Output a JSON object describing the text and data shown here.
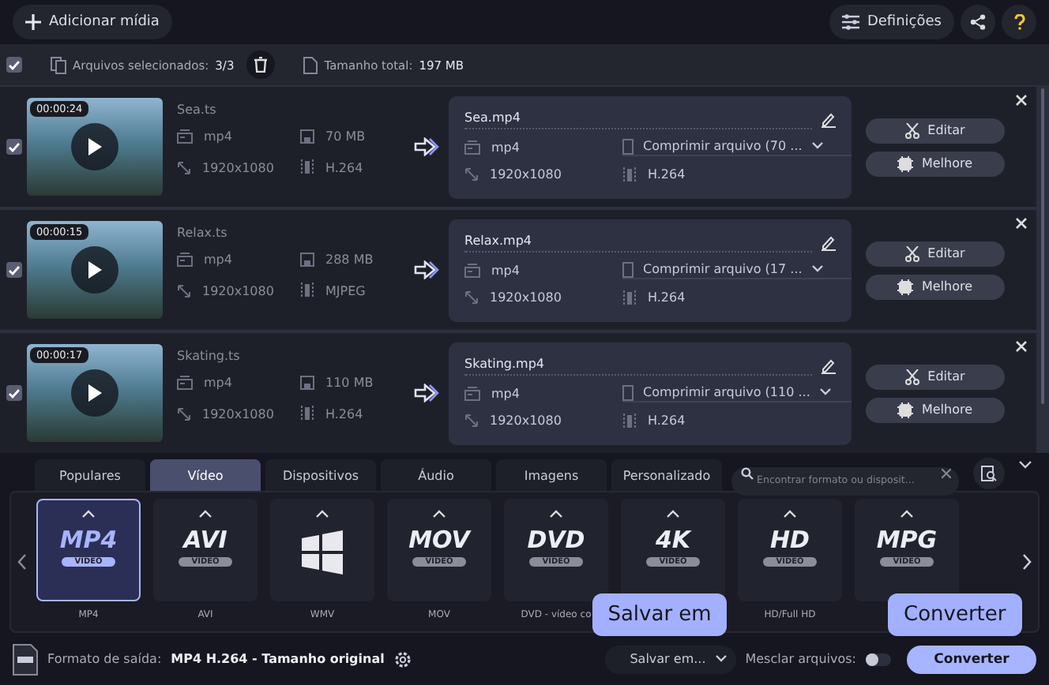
{
  "toolbar": {
    "add_media": "Adicionar mídia",
    "settings": "Definições"
  },
  "selection_bar": {
    "all_checked": true,
    "selected_label": "Arquivos selecionados:",
    "selected_count": "3/3",
    "total_label": "Tamanho total:",
    "total_size": "197 MB"
  },
  "files": [
    {
      "checked": true,
      "duration": "00:00:24",
      "name": "Sea.ts",
      "format": "mp4",
      "size": "70 MB",
      "resolution": "1920x1080",
      "codec": "H.264",
      "output": {
        "name": "Sea.mp4",
        "format": "mp4",
        "profile": "Comprimir arquivo (70 ...",
        "resolution": "1920x1080",
        "codec": "H.264"
      },
      "edit": "Editar",
      "enhance": "Melhore"
    },
    {
      "checked": true,
      "duration": "00:00:15",
      "name": "Relax.ts",
      "format": "mp4",
      "size": "288 MB",
      "resolution": "1920x1080",
      "codec": "MJPEG",
      "output": {
        "name": "Relax.mp4",
        "format": "mp4",
        "profile": "Comprimir arquivo (17 ...",
        "resolution": "1920x1080",
        "codec": "H.264"
      },
      "edit": "Editar",
      "enhance": "Melhore"
    },
    {
      "checked": true,
      "duration": "00:00:17",
      "name": "Skating.ts",
      "format": "mp4",
      "size": "110 MB",
      "resolution": "1920x1080",
      "codec": "H.264",
      "output": {
        "name": "Skating.mp4",
        "format": "mp4",
        "profile": "Comprimir arquivo (110 ...",
        "resolution": "1920x1080",
        "codec": "H.264"
      },
      "edit": "Editar",
      "enhance": "Melhore"
    }
  ],
  "format_tabs": [
    {
      "label": "Populares",
      "selected": false
    },
    {
      "label": "Vídeo",
      "selected": true
    },
    {
      "label": "Dispositivos",
      "selected": false
    },
    {
      "label": "Áudio",
      "selected": false
    },
    {
      "label": "Imagens",
      "selected": false
    },
    {
      "label": "Personalizado",
      "selected": false
    }
  ],
  "format_search": {
    "placeholder": "Encontrar formato ou disposit..."
  },
  "formats": [
    {
      "kind": "text",
      "logo": "MP4",
      "sub": "VIDEO",
      "label": "MP4",
      "selected": true
    },
    {
      "kind": "text",
      "logo": "AVI",
      "sub": "VIDEO",
      "label": "AVI",
      "selected": false
    },
    {
      "kind": "windows",
      "label": "WMV",
      "selected": false
    },
    {
      "kind": "text",
      "logo": "MOV",
      "sub": "VIDEO",
      "label": "MOV",
      "selected": false
    },
    {
      "kind": "text",
      "logo": "DVD",
      "sub": "VIDEO",
      "label": "DVD - vídeo co",
      "selected": false
    },
    {
      "kind": "text",
      "logo": "4K",
      "sub": "VIDEO",
      "selected": false
    },
    {
      "kind": "text",
      "logo": "HD",
      "sub": "VIDEO",
      "label": "HD/Full HD",
      "selected": false
    },
    {
      "kind": "text",
      "logo": "MPG",
      "sub": "VIDEO",
      "selected": false
    }
  ],
  "output_bar": {
    "format_label": "Formato de saída:",
    "format_value": "MP4 H.264 - Tamanho original",
    "save_to": "Salvar em...",
    "merge_label": "Mesclar arquivos:",
    "merge_on": false,
    "convert": "Converter"
  },
  "tooltips": {
    "save_to": "Salvar em",
    "convert": "Converter"
  }
}
